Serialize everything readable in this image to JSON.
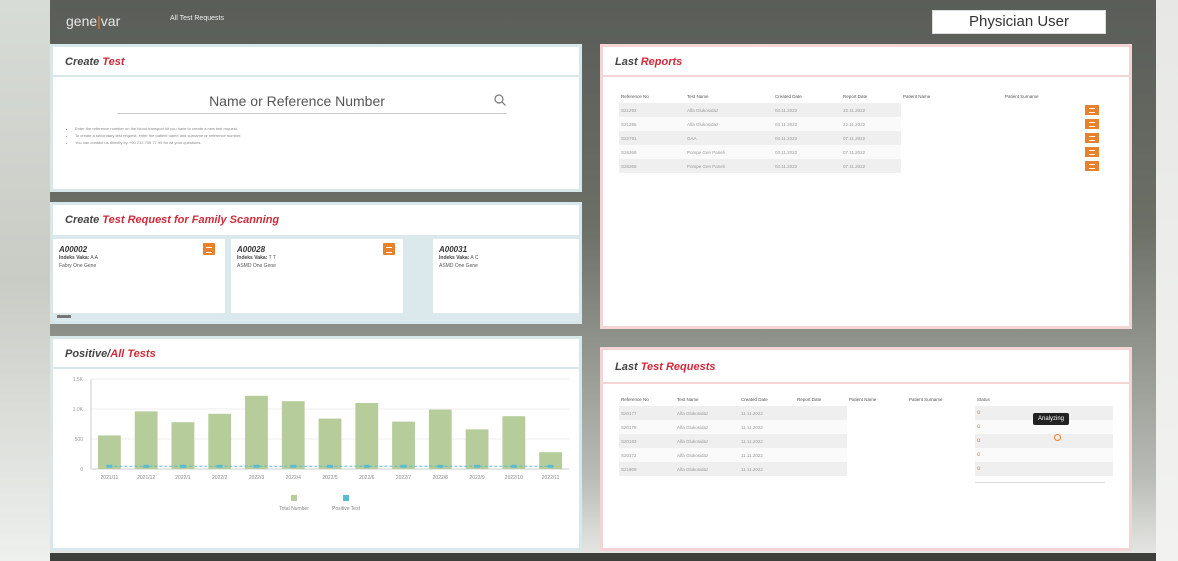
{
  "header": {
    "logo_left": "gene",
    "logo_accent": "|",
    "logo_right": "var",
    "nav_link": "All Test Requests",
    "user_label": "Physician User"
  },
  "create_test": {
    "title_plain": "Create ",
    "title_accent": "Test",
    "search_placeholder": "Name or Reference Number",
    "notes": [
      "Enter the reference number on the blood transport kit you have to create a new test request.",
      "To create a secondary test request, enter the patient name and surname or reference number.",
      "You can contact us directly by +90 212 705 77 99 for all your questions."
    ]
  },
  "family": {
    "title_plain": "Create ",
    "title_accent": "Test Request for Family Scanning",
    "index_label": "Indeks Vaka:",
    "cards": [
      {
        "code": "A00002",
        "index_value": "A A",
        "gene": "Fabry One Gene",
        "has_button": true
      },
      {
        "code": "A00028",
        "index_value": "T T",
        "gene": "ASMD One Gene",
        "has_button": true
      },
      {
        "code": "A00031",
        "index_value": "A C",
        "gene": "ASMD One Gene",
        "has_button": false
      }
    ]
  },
  "positive": {
    "title_plain": "Positive/",
    "title_accent": "All Tests"
  },
  "chart_data": {
    "type": "bar",
    "title": "Positive/All Tests",
    "categories": [
      "2021/11",
      "2021/12",
      "2022/1",
      "2022/2",
      "2022/3",
      "2022/4",
      "2022/5",
      "2022/6",
      "2022/7",
      "2022/8",
      "2022/9",
      "2022/10",
      "2022/11"
    ],
    "ylim": [
      0,
      1500
    ],
    "yticks": [
      "0",
      "500",
      "1.0K",
      "1.5K"
    ],
    "series": [
      {
        "name": "Total Number",
        "color": "#b6cc9a",
        "values": [
          560,
          960,
          780,
          920,
          1220,
          1130,
          840,
          1100,
          790,
          990,
          660,
          880,
          280
        ]
      },
      {
        "name": "Positive Test",
        "color": "#5bbcd0",
        "values": [
          70,
          70,
          70,
          70,
          70,
          70,
          70,
          70,
          70,
          70,
          70,
          70,
          70
        ]
      }
    ],
    "legend": "bottom"
  },
  "reports": {
    "title_plain": "Last ",
    "title_accent": "Reports",
    "columns": [
      "Reference No",
      "Test Name",
      "Created Date",
      "Report Date",
      "Patient Name",
      "Patient Surname"
    ],
    "rows": [
      {
        "ref": "S21292",
        "test": "Alfa Glukosidaz",
        "created": "03.11.2022",
        "report": "22.11.2022"
      },
      {
        "ref": "S21285",
        "test": "Alfa Glukosidaz",
        "created": "03.11.2022",
        "report": "22.11.2022"
      },
      {
        "ref": "S22791",
        "test": "GAA",
        "created": "03.11.2022",
        "report": "07.11.2022"
      },
      {
        "ref": "S26368",
        "test": "Pompe Gen Paneli",
        "created": "03.11.2022",
        "report": "07.11.2022"
      },
      {
        "ref": "S26368",
        "test": "Pompe Gen Paneli",
        "created": "03.11.2022",
        "report": "07.11.2022"
      }
    ]
  },
  "requests": {
    "title_plain": "Last ",
    "title_accent": "Test Requests",
    "columns": [
      "Reference No",
      "Test Name",
      "Created Date",
      "Report Date",
      "Patient Name",
      "Patient Surname",
      "Status"
    ],
    "rows": [
      {
        "ref": "S20177",
        "test": "Alfa Glukosidaz",
        "created": "11.11.2022"
      },
      {
        "ref": "S20178",
        "test": "Alfa Glukosidaz",
        "created": "11.11.2022"
      },
      {
        "ref": "S20183",
        "test": "Alfa Glukosidaz",
        "created": "11.11.2022"
      },
      {
        "ref": "S20172",
        "test": "Alfa Glukosidaz",
        "created": "11.11.2022"
      },
      {
        "ref": "S21809",
        "test": "Alfa Glukosidaz",
        "created": "11.11.2022"
      }
    ],
    "status_dot": "o",
    "tooltip": "Analyzing"
  }
}
